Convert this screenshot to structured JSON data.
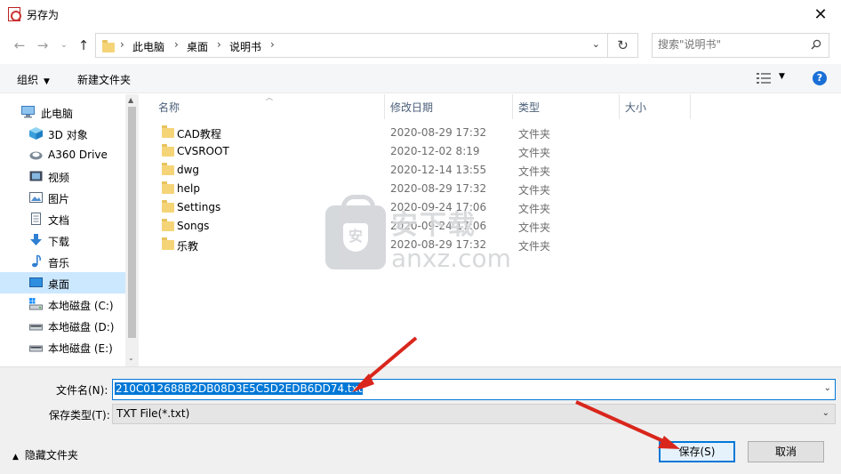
{
  "window": {
    "title": "另存为",
    "close_glyph": "✕"
  },
  "address": {
    "crumbs": [
      "此电脑",
      "桌面",
      "说明书"
    ],
    "separator": "›",
    "search_placeholder": "搜索\"说明书\""
  },
  "toolbar": {
    "organize_label": "组织",
    "new_folder_label": "新建文件夹",
    "help_glyph": "?"
  },
  "nav": {
    "items": [
      {
        "label": "此电脑",
        "icon": "computer-icon"
      },
      {
        "label": "3D 对象",
        "icon": "cube-3d-icon"
      },
      {
        "label": "A360 Drive",
        "icon": "cloud-drive-icon"
      },
      {
        "label": "视频",
        "icon": "video-icon"
      },
      {
        "label": "图片",
        "icon": "picture-icon"
      },
      {
        "label": "文档",
        "icon": "document-icon"
      },
      {
        "label": "下载",
        "icon": "download-icon"
      },
      {
        "label": "音乐",
        "icon": "music-icon"
      },
      {
        "label": "桌面",
        "icon": "desktop-icon",
        "selected": true
      },
      {
        "label": "本地磁盘 (C:)",
        "icon": "drive-c-icon"
      },
      {
        "label": "本地磁盘 (D:)",
        "icon": "drive-icon"
      },
      {
        "label": "本地磁盘 (E:)",
        "icon": "drive-icon"
      }
    ]
  },
  "columns": {
    "name": "名称",
    "date": "修改日期",
    "type": "类型",
    "size": "大小"
  },
  "files": [
    {
      "name": "CAD教程",
      "date": "2020-08-29 17:32",
      "type": "文件夹"
    },
    {
      "name": "CVSROOT",
      "date": "2020-12-02 8:19",
      "type": "文件夹"
    },
    {
      "name": "dwg",
      "date": "2020-12-14 13:55",
      "type": "文件夹"
    },
    {
      "name": "help",
      "date": "2020-08-29 17:32",
      "type": "文件夹"
    },
    {
      "name": "Settings",
      "date": "2020-09-24 17:06",
      "type": "文件夹"
    },
    {
      "name": "Songs",
      "date": "2020-09-24 17:06",
      "type": "文件夹"
    },
    {
      "name": "乐教",
      "date": "2020-08-29 17:32",
      "type": "文件夹"
    }
  ],
  "watermark": {
    "cn": "安下载",
    "en": "anxz.com"
  },
  "form": {
    "filename_label": "文件名(N):",
    "filename_value": "210C012688B2DB08D3E5C5D2EDB6DD74.txt",
    "filetype_label": "保存类型(T):",
    "filetype_value": "TXT File(*.txt)",
    "hide_folders_label": "隐藏文件夹",
    "save_label": "保存(S)",
    "cancel_label": "取消"
  },
  "colors": {
    "accent": "#0078d7",
    "selection": "#cce8ff",
    "arrow": "#d9261c"
  }
}
